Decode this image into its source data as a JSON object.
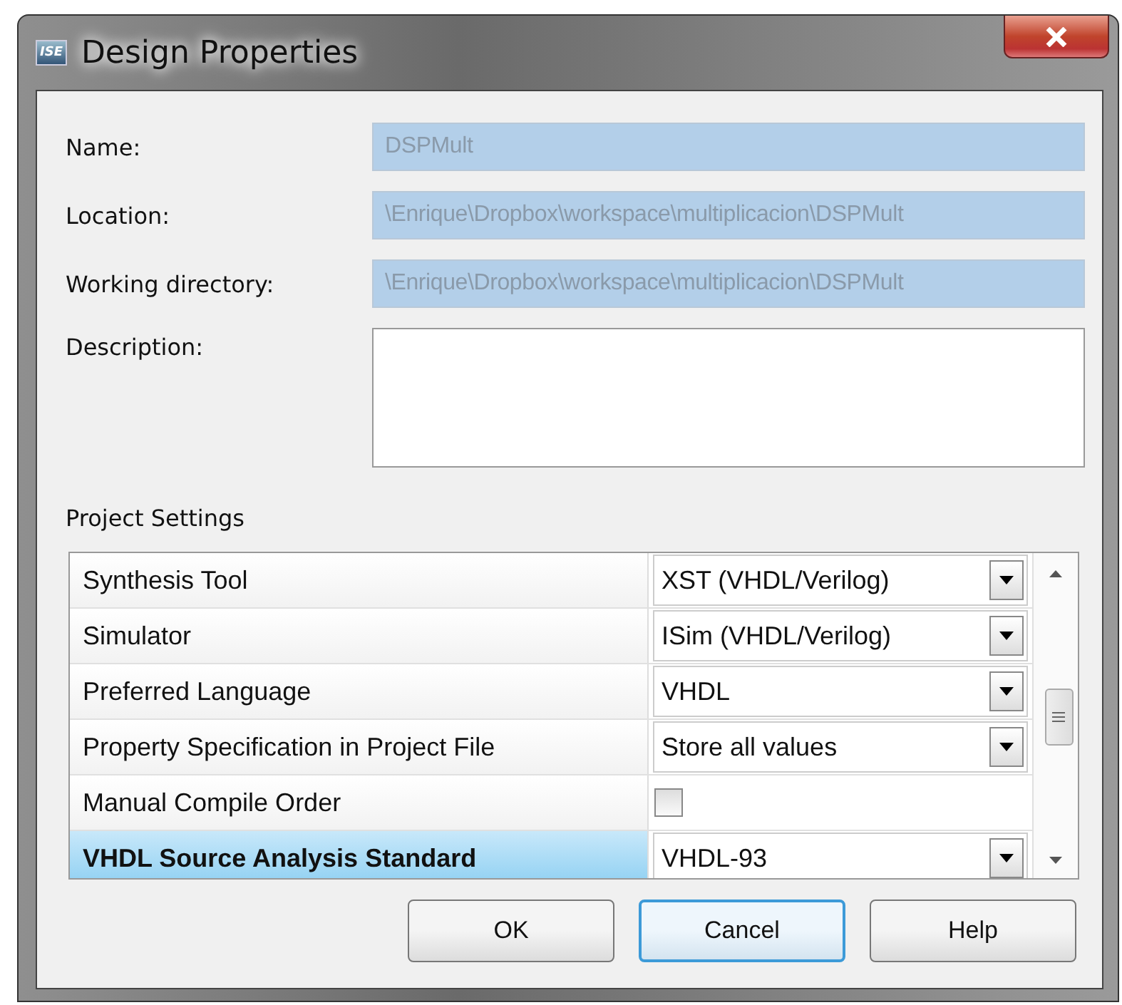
{
  "window": {
    "title": "Design Properties",
    "app_badge": "ISE"
  },
  "fields": [
    {
      "label": "Name:",
      "value": "DSPMult",
      "kind": "text"
    },
    {
      "label": "Location:",
      "value": "\\Enrique\\Dropbox\\workspace\\multiplicacion\\DSPMult",
      "kind": "text"
    },
    {
      "label": "Working directory:",
      "value": "\\Enrique\\Dropbox\\workspace\\multiplicacion\\DSPMult",
      "kind": "text"
    },
    {
      "label": "Description:",
      "kind": "textarea"
    }
  ],
  "settings": {
    "title": "Project Settings",
    "rows": [
      {
        "name": "Synthesis Tool",
        "kind": "dropdown",
        "value": "XST (VHDL/Verilog)",
        "selected": false
      },
      {
        "name": "Simulator",
        "kind": "dropdown",
        "value": "ISim (VHDL/Verilog)",
        "selected": false
      },
      {
        "name": "Preferred Language",
        "kind": "dropdown",
        "value": "VHDL",
        "selected": false
      },
      {
        "name": "Property Specification in Project File",
        "kind": "dropdown",
        "value": "Store all values",
        "selected": false
      },
      {
        "name": "Manual Compile Order",
        "kind": "checkbox",
        "checked": false,
        "selected": false
      },
      {
        "name": "VHDL Source Analysis Standard",
        "kind": "dropdown",
        "value": "VHDL-93",
        "selected": true
      }
    ]
  },
  "buttons": [
    {
      "label": "OK",
      "focused": false
    },
    {
      "label": "Cancel",
      "focused": true
    },
    {
      "label": "Help",
      "focused": false
    }
  ]
}
